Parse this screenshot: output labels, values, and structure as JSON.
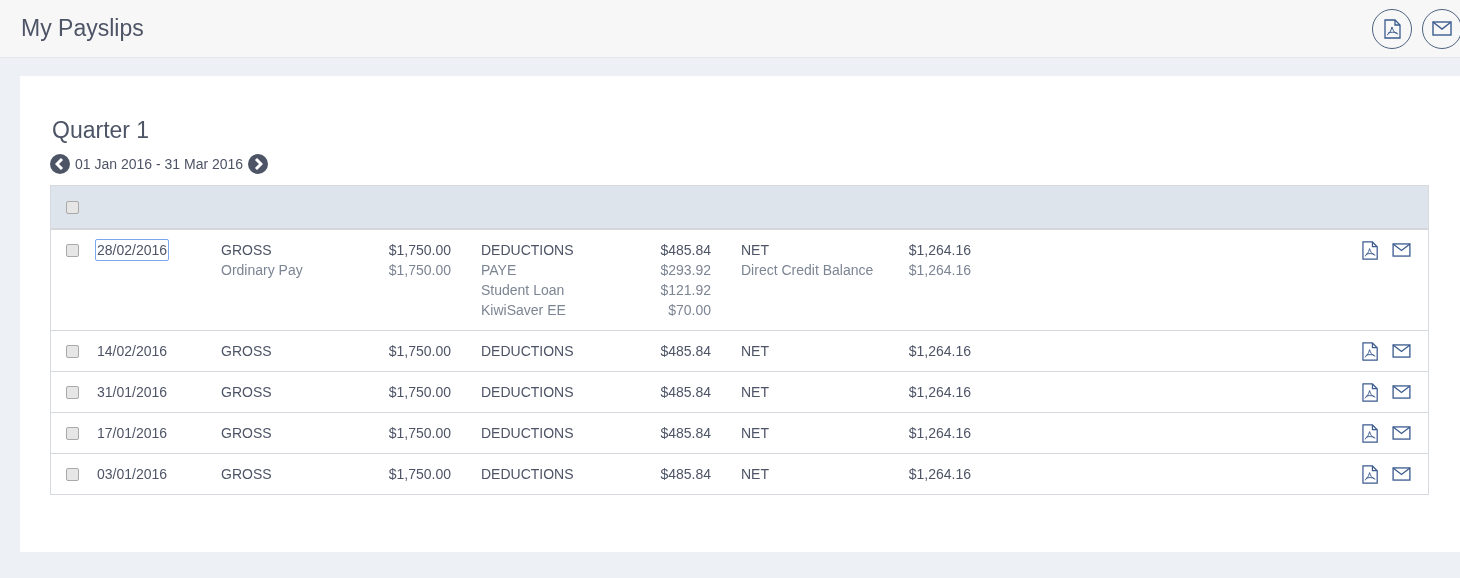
{
  "page_title": "My Payslips",
  "period": {
    "title": "Quarter 1",
    "range": "01 Jan 2016 - 31 Mar 2016"
  },
  "table": {
    "select_all": {
      "checked": false
    },
    "rows": [
      {
        "checked": false,
        "selected": true,
        "date": "28/02/2016",
        "gross": {
          "label": "GROSS",
          "amount": "$1,750.00",
          "items": [
            {
              "label": "Ordinary Pay",
              "amount": "$1,750.00"
            }
          ]
        },
        "deductions": {
          "label": "DEDUCTIONS",
          "amount": "$485.84",
          "items": [
            {
              "label": "PAYE",
              "amount": "$293.92"
            },
            {
              "label": "Student Loan",
              "amount": "$121.92"
            },
            {
              "label": "KiwiSaver EE",
              "amount": "$70.00"
            }
          ]
        },
        "net": {
          "label": "NET",
          "amount": "$1,264.16",
          "items": [
            {
              "label": "Direct Credit Balance",
              "amount": "$1,264.16"
            }
          ]
        }
      },
      {
        "checked": false,
        "selected": false,
        "date": "14/02/2016",
        "gross": {
          "label": "GROSS",
          "amount": "$1,750.00"
        },
        "deductions": {
          "label": "DEDUCTIONS",
          "amount": "$485.84"
        },
        "net": {
          "label": "NET",
          "amount": "$1,264.16"
        }
      },
      {
        "checked": false,
        "selected": false,
        "date": "31/01/2016",
        "gross": {
          "label": "GROSS",
          "amount": "$1,750.00"
        },
        "deductions": {
          "label": "DEDUCTIONS",
          "amount": "$485.84"
        },
        "net": {
          "label": "NET",
          "amount": "$1,264.16"
        }
      },
      {
        "checked": false,
        "selected": false,
        "date": "17/01/2016",
        "gross": {
          "label": "GROSS",
          "amount": "$1,750.00"
        },
        "deductions": {
          "label": "DEDUCTIONS",
          "amount": "$485.84"
        },
        "net": {
          "label": "NET",
          "amount": "$1,264.16"
        }
      },
      {
        "checked": false,
        "selected": false,
        "date": "03/01/2016",
        "gross": {
          "label": "GROSS",
          "amount": "$1,750.00"
        },
        "deductions": {
          "label": "DEDUCTIONS",
          "amount": "$485.84"
        },
        "net": {
          "label": "NET",
          "amount": "$1,264.16"
        }
      }
    ]
  }
}
